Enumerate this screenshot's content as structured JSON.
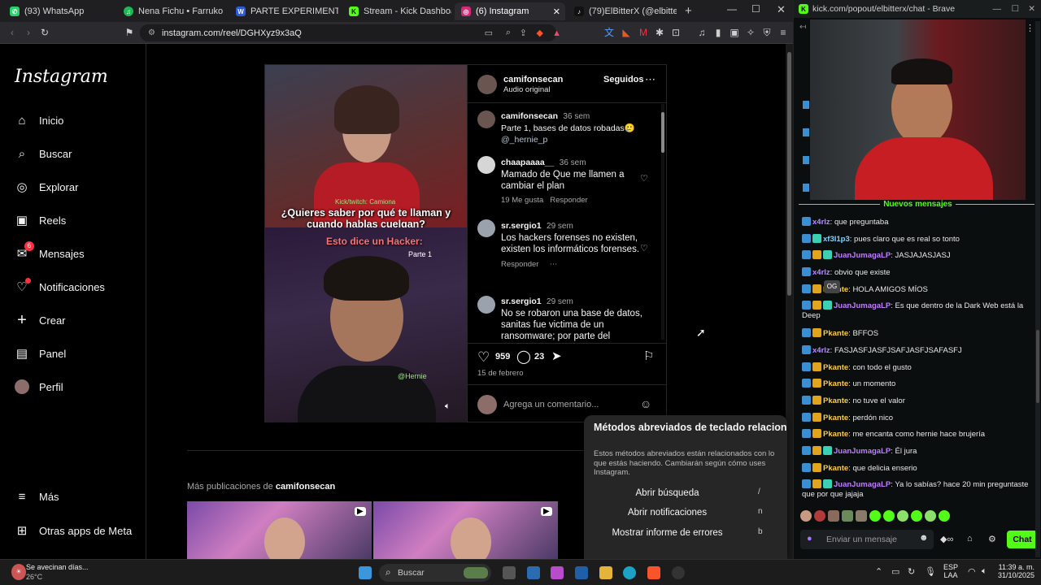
{
  "browser": {
    "tabs": [
      {
        "label": "(93) WhatsApp",
        "color": "#25d366",
        "glyph": "✆"
      },
      {
        "label": "Nena Fichu • Farruko",
        "color": "#1db954",
        "glyph": "♫"
      },
      {
        "label": "PARTE EXPERIMENTAL TESIS",
        "color": "#2d5bd8",
        "glyph": "W"
      },
      {
        "label": "Stream - Kick Dashboard",
        "color": "#53fc18",
        "glyph": "K"
      },
      {
        "label": "(6) Instagram",
        "color": "#d62976",
        "glyph": "◎"
      },
      {
        "label": "(79)ElBitterX (@elbitterx.kick)",
        "color": "#111111",
        "glyph": "♪"
      }
    ],
    "url": "instagram.com/reel/DGHXyz9x3aQ"
  },
  "instagram": {
    "logo": "Instagram",
    "nav": [
      {
        "label": "Inicio",
        "icon": "home-icon",
        "glyph": "⌂"
      },
      {
        "label": "Buscar",
        "icon": "search-icon",
        "glyph": "⌕"
      },
      {
        "label": "Explorar",
        "icon": "compass-icon",
        "glyph": "◎"
      },
      {
        "label": "Reels",
        "icon": "reels-icon",
        "glyph": "▣"
      },
      {
        "label": "Mensajes",
        "icon": "messenger-icon",
        "glyph": "✉",
        "badge": "6"
      },
      {
        "label": "Notificaciones",
        "icon": "heart-icon",
        "glyph": "♡",
        "dot": true
      },
      {
        "label": "Crear",
        "icon": "plus-icon",
        "glyph": "+"
      },
      {
        "label": "Panel",
        "icon": "dashboard-icon",
        "glyph": "▤"
      },
      {
        "label": "Perfil",
        "icon": "profile-avatar",
        "glyph": "●"
      }
    ],
    "more": "Más",
    "meta_apps": "Otras apps de Meta",
    "post": {
      "username": "camifonsecan",
      "audio": "Audio original",
      "follow_status": "Seguidos",
      "video_tag": "Kick/twitch: Camiona",
      "video_caption": "¿Quieres saber por qué te llaman y cuando hablas cuelgan?",
      "video_subtitle": "Esto dice un Hacker:",
      "video_part": "Parte 1",
      "video_handle": "@Hernie",
      "likes": "959",
      "comments_count": "23",
      "date": "15 de febrero",
      "add_comment_placeholder": "Agrega un comentario...",
      "comments": [
        {
          "user": "camifonsecan",
          "time": "36 sem",
          "text": "Parte 1, bases de datos robadas🥲",
          "mention": "@_hernie_p"
        },
        {
          "user": "chaapaaaa__",
          "time": "36 sem",
          "text": "Mamado de Que me llamen a cambiar el plan",
          "likes": "19 Me gusta",
          "reply": "Responder"
        },
        {
          "user": "sr.sergio1",
          "time": "29 sem",
          "text": "Los hackers forenses no existen, existen los informáticos forenses.",
          "reply": "Responder"
        },
        {
          "user": "sr.sergio1",
          "time": "29 sem",
          "text": "No se robaron una base de datos, sanitas fue victima de un ransomware; por parte del"
        }
      ]
    },
    "more_posts_prefix": "Más publicaciones de",
    "more_posts_user": "camifonsecan",
    "shortcuts": {
      "title": "Métodos abreviados de teclado relacionados",
      "description": "Estos métodos abreviados están relacionados con lo que estás haciendo. Cambiarán según cómo uses Instagram.",
      "items": [
        {
          "label": "Abrir búsqueda",
          "key": "/"
        },
        {
          "label": "Abrir notificaciones",
          "key": "n"
        },
        {
          "label": "Mostrar informe de errores",
          "key": "b"
        }
      ]
    }
  },
  "kick": {
    "window_title": "kick.com/popout/elbitterx/chat - Brave",
    "new_messages": "Nuevos mensajes",
    "og_badge": "OG",
    "messages": [
      {
        "user": "x4rlz",
        "text": "que preguntaba",
        "color": "#b58cff"
      },
      {
        "user": "xf3l1p3",
        "text": "pues claro que es real so tonto",
        "color": "#7fd4ff"
      },
      {
        "user": "JuanJumagaLP",
        "text": "JASJAJASJASJ",
        "color": "#c07dff"
      },
      {
        "user": "x4rlz",
        "text": "obvio que existe",
        "color": "#b58cff"
      },
      {
        "user": "Pkante",
        "text": "HOLA AMIGOS MÍOS",
        "color": "#ffcc33"
      },
      {
        "user": "JuanJumagaLP",
        "text": "Es que dentro de la Dark Web está la Deep",
        "color": "#c07dff"
      },
      {
        "user": "Pkante",
        "text": "BFFOS",
        "color": "#ffcc33"
      },
      {
        "user": "x4rlz",
        "text": "FASJASFJASFJSAFJASFJSAFASFJ",
        "color": "#b58cff"
      },
      {
        "user": "Pkante",
        "text": "con todo el gusto",
        "color": "#ffcc33"
      },
      {
        "user": "Pkante",
        "text": "un momento",
        "color": "#ffcc33"
      },
      {
        "user": "Pkante",
        "text": "no tuve el valor",
        "color": "#ffcc33"
      },
      {
        "user": "Pkante",
        "text": "perdón nico",
        "color": "#ffcc33"
      },
      {
        "user": "Pkante",
        "text": "me encanta como hernie hace brujería",
        "color": "#ffcc33"
      },
      {
        "user": "JuanJumagaLP",
        "text": "Él jura",
        "color": "#c07dff"
      },
      {
        "user": "Pkante",
        "text": "que delicia enserio",
        "color": "#ffcc33"
      },
      {
        "user": "JuanJumagaLP",
        "text": "Ya lo sabías? hace 20 min preguntaste que por que jajaja",
        "color": "#c07dff"
      }
    ],
    "input_placeholder": "Enviar un mensaje",
    "chat_button": "Chat"
  },
  "taskbar": {
    "weather_text": "Se avecinan días...",
    "weather_temp": "26°C",
    "search_placeholder": "Buscar",
    "lang_top": "ESP",
    "lang_bottom": "LAA",
    "time": "11:39 a. m.",
    "date": "31/10/2025"
  }
}
